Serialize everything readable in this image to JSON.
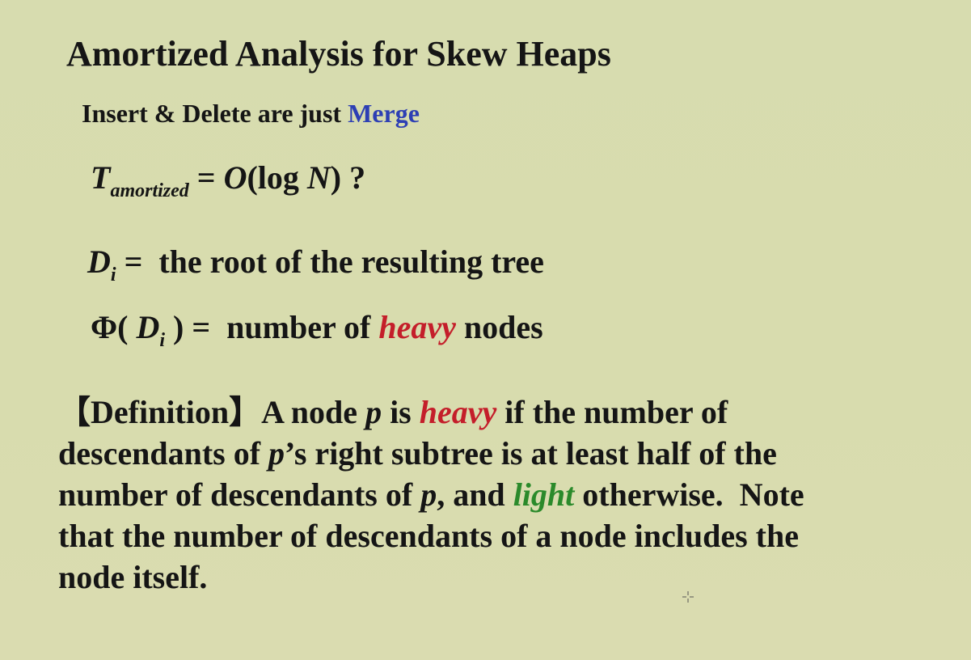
{
  "slide": {
    "title": "Amortized Analysis for Skew Heaps",
    "subtitle": {
      "prefix": "Insert & Delete are just ",
      "merge": "Merge"
    },
    "amortized": {
      "T": "T",
      "sub": "amortized",
      "eq": " = ",
      "O": "O",
      "arg_open": "(log ",
      "N": "N",
      "arg_close": ") ?"
    },
    "d_def": {
      "D": "D",
      "sub": "i",
      "eq": " =  ",
      "text": "the root of the resulting tree"
    },
    "phi_def": {
      "phi": "Φ( ",
      "D": "D",
      "sub": "i",
      "close": " ) =  ",
      "pre": "number of ",
      "heavy": "heavy",
      "post": " nodes"
    },
    "definition": {
      "label": "【Definition】",
      "t1": "A node ",
      "p1": "p",
      "t2": " is ",
      "heavy": "heavy",
      "t3": " if the number of descendants of ",
      "p2": "p",
      "t4": "’s right subtree is at least half of the number of descendants of ",
      "p3": "p",
      "t5": ", and ",
      "light": "light",
      "t6": " otherwise.  Note that the number of descendants of a node includes the node itself."
    }
  },
  "colors": {
    "background": "#d7dcaf",
    "text": "#151515",
    "merge": "#2d3fb4",
    "heavy": "#c41e2a",
    "light": "#2b8a2b"
  },
  "icons": {
    "cursor": "crosshair-cursor-icon"
  }
}
